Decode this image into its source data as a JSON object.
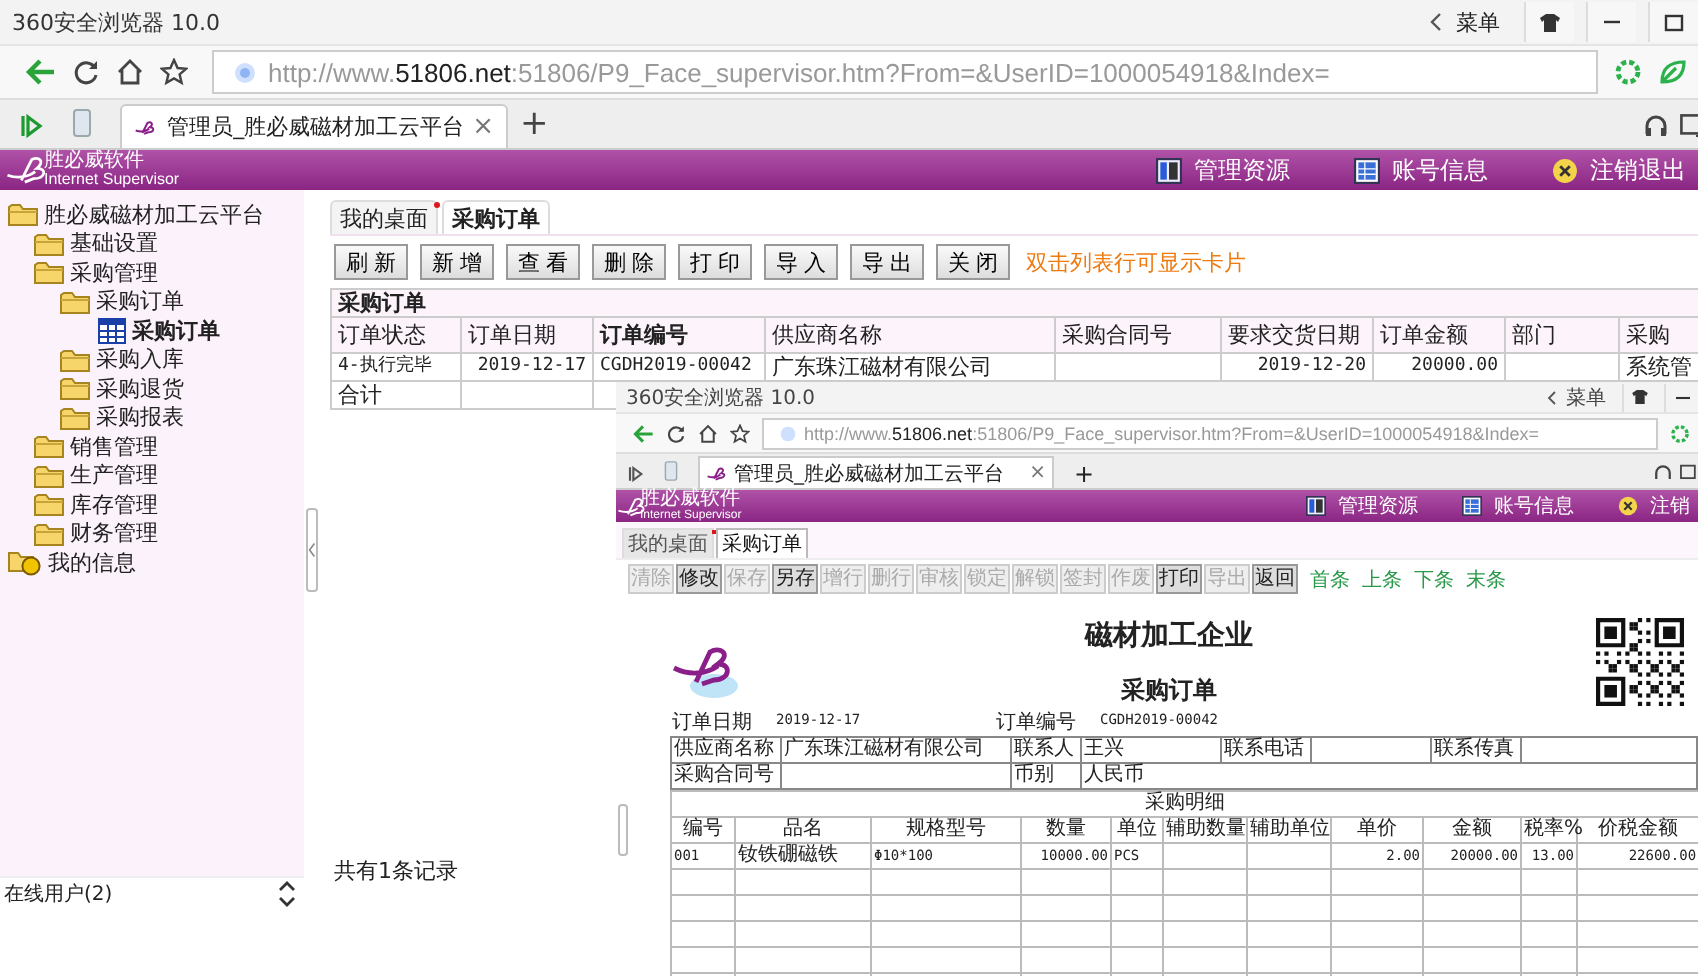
{
  "browser": {
    "title": "360安全浏览器 10.0",
    "menu_label": "菜单",
    "url": "http://www.**51806.net**:51806/P9_Face_supervisor.htm?From=&UserID=1000054918&Index=",
    "tab": {
      "title": "管理员_胜必威磁材加工云平台",
      "close": "×"
    },
    "new_tab": "+"
  },
  "app_header": {
    "brand": "胜必威软件",
    "tagline": "Internet Supervisor",
    "menu": [
      {
        "label": "管理资源",
        "kind": "resources"
      },
      {
        "label": "账号信息",
        "kind": "account"
      },
      {
        "label": "注销退出",
        "kind": "logout"
      }
    ]
  },
  "sidebar": {
    "tree": [
      {
        "label": "胜必威磁材加工云平台",
        "kind": "folder",
        "selected": false,
        "children": [
          {
            "label": "基础设置",
            "kind": "folder",
            "selected": false
          },
          {
            "label": "采购管理",
            "kind": "folder",
            "selected": false,
            "children": [
              {
                "label": "采购订单",
                "kind": "folder",
                "selected": false,
                "children": [
                  {
                    "label": "采购订单",
                    "kind": "table",
                    "selected": true
                  }
                ]
              },
              {
                "label": "采购入库",
                "kind": "folder",
                "selected": false
              },
              {
                "label": "采购退货",
                "kind": "folder",
                "selected": false
              },
              {
                "label": "采购报表",
                "kind": "folder",
                "selected": false
              }
            ]
          },
          {
            "label": "销售管理",
            "kind": "folder",
            "selected": false
          },
          {
            "label": "生产管理",
            "kind": "folder",
            "selected": false
          },
          {
            "label": "库存管理",
            "kind": "folder",
            "selected": false
          },
          {
            "label": "财务管理",
            "kind": "folder",
            "selected": false
          }
        ]
      },
      {
        "label": "我的信息",
        "kind": "user",
        "selected": false
      }
    ],
    "footer": "在线用户(2)"
  },
  "main_tabs": [
    {
      "label": "我的桌面",
      "selected": false,
      "marked": true
    },
    {
      "label": "采购订单",
      "selected": true,
      "marked": false
    }
  ],
  "toolbar": {
    "buttons": [
      "刷新",
      "新增",
      "查看",
      "删除",
      "打印",
      "导入",
      "导出",
      "关闭"
    ],
    "hint": "双击列表行可显示卡片"
  },
  "table": {
    "title": "采购订单",
    "columns": [
      {
        "label": "订单状态",
        "sorted": false
      },
      {
        "label": "订单日期",
        "sorted": false
      },
      {
        "label": "订单编号",
        "sorted": true
      },
      {
        "label": "供应商名称",
        "sorted": false
      },
      {
        "label": "采购合同号",
        "sorted": false
      },
      {
        "label": "要求交货日期",
        "sorted": false
      },
      {
        "label": "订单金额",
        "sorted": false
      },
      {
        "label": "部门",
        "sorted": false
      },
      {
        "label": "采购",
        "sorted": false
      }
    ],
    "rows": [
      [
        "4-执行完毕",
        "2019-12-17",
        "CGDH2019-00042",
        "广东珠江磁材有限公司",
        null,
        "2019-12-20",
        "20000.00",
        null,
        "系统管"
      ]
    ],
    "total_row": [
      "合计"
    ]
  },
  "record_count": "共有1条记录",
  "inner_screenshot": {
    "title": "360安全浏览器 10.0",
    "menu_label": "菜单",
    "url": "http://www.**51806.net**:51806/P9_Face_supervisor.htm?From=&UserID=1000054918&Index=",
    "tab_title": "管理员_胜必威磁材加工云平台",
    "tab_close": "×",
    "new_tab": "+",
    "brand": "胜必威软件",
    "tagline": "Internet Supervisor",
    "menu": [
      {
        "label": "管理资源",
        "kind": "resources"
      },
      {
        "label": "账号信息",
        "kind": "account"
      },
      {
        "label": "注销",
        "kind": "logout"
      }
    ],
    "tabs": [
      {
        "label": "我的桌面",
        "selected": false,
        "marked": true
      },
      {
        "label": "采购订单",
        "selected": true,
        "marked": false
      }
    ],
    "toolbar": [
      {
        "label": "清除",
        "disabled": true
      },
      {
        "label": "修改",
        "disabled": false
      },
      {
        "label": "保存",
        "disabled": true
      },
      {
        "label": "另存",
        "disabled": false
      },
      {
        "label": "增行",
        "disabled": true
      },
      {
        "label": "删行",
        "disabled": true
      },
      {
        "label": "审核",
        "disabled": true
      },
      {
        "label": "锁定",
        "disabled": true
      },
      {
        "label": "解锁",
        "disabled": true
      },
      {
        "label": "签封",
        "disabled": true
      },
      {
        "label": "作废",
        "disabled": true
      },
      {
        "label": "打印",
        "disabled": false
      },
      {
        "label": "导出",
        "disabled": true
      },
      {
        "label": "返回",
        "disabled": false
      }
    ],
    "nav_links": [
      "首条",
      "上条",
      "下条",
      "末条"
    ],
    "document": {
      "company": "磁材加工企业",
      "title": "采购订单",
      "meta": [
        {
          "label": "订单日期",
          "value": "2019-12-17"
        },
        {
          "label": "订单编号",
          "value": "CGDH2019-00042"
        }
      ],
      "info_rows": [
        [
          {
            "label": "供应商名称",
            "value": "广东珠江磁材有限公司"
          },
          {
            "label": "联系人",
            "value": "王兴"
          },
          {
            "label": "联系电话"
          },
          {
            "label": "联系传真"
          }
        ],
        [
          {
            "label": "采购合同号"
          },
          {
            "label": "币别",
            "value": "人民币"
          }
        ]
      ],
      "detail_title": "采购明细",
      "columns": [
        "编号",
        "品名",
        "规格型号",
        "数量",
        "单位",
        "辅助数量",
        "辅助单位",
        "单价",
        "金额",
        "税率%",
        "价税金额"
      ],
      "rows": [
        [
          "001",
          "钕铁硼磁铁",
          "Φ10*100",
          "10000.00",
          "PCS",
          null,
          null,
          "2.00",
          "20000.00",
          "13.00",
          "22600.00"
        ]
      ]
    }
  }
}
